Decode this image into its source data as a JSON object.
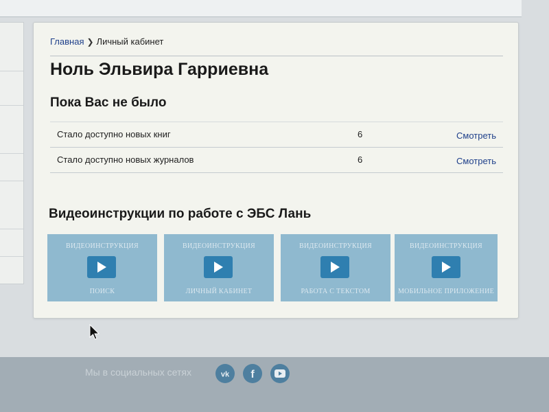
{
  "breadcrumb": {
    "home": "Главная",
    "current": "Личный кабинет"
  },
  "user": {
    "name": "Ноль Эльвира Гарриевна"
  },
  "while_away": {
    "title": "Пока Вас не было",
    "rows": [
      {
        "label": "Стало доступно новых книг",
        "count": "6",
        "action": "Смотреть"
      },
      {
        "label": "Стало доступно новых журналов",
        "count": "6",
        "action": "Смотреть"
      }
    ]
  },
  "videos": {
    "title": "Видеоинструкции по работе с ЭБС Лань",
    "items": [
      {
        "top": "Видеоинструкция",
        "bottom": "Поиск"
      },
      {
        "top": "Видеоинструкция",
        "bottom": "Личный кабинет"
      },
      {
        "top": "Видеоинструкция",
        "bottom": "Работа с текстом"
      },
      {
        "top": "Видеоинструкция",
        "bottom": "Мобильное приложение"
      }
    ]
  },
  "footer": {
    "text": "Мы в социальных сетях",
    "social": [
      "vk-icon",
      "facebook-icon",
      "youtube-icon"
    ]
  },
  "colors": {
    "link": "#1e3f8a",
    "video_tile": "#8fb9cf",
    "play_button": "#2f7fb0",
    "social": "#4e7f9f"
  }
}
